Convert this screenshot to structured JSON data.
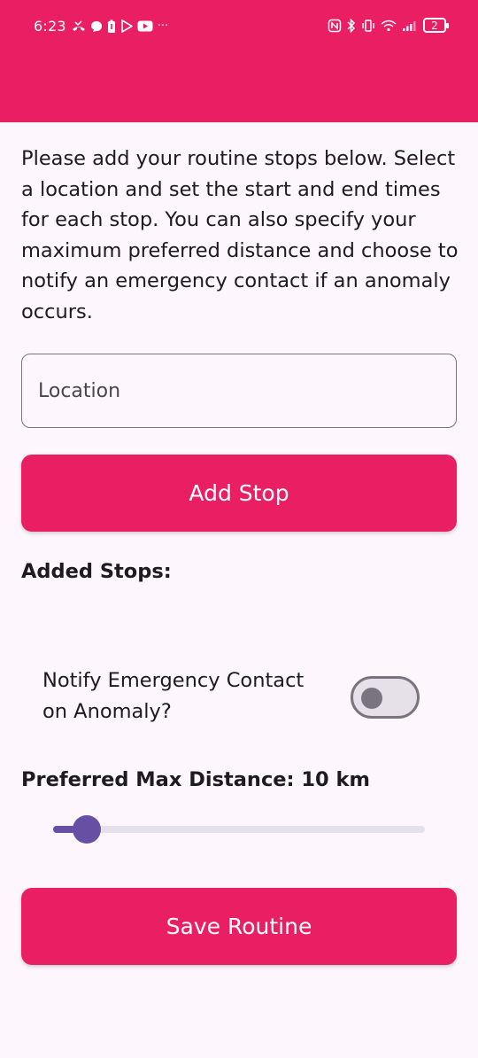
{
  "status_bar": {
    "time": "6:23",
    "left_icons": [
      "missed-call-icon",
      "chat-icon",
      "battery-saver-icon",
      "play-store-icon",
      "youtube-icon",
      "more-dots-icon"
    ],
    "right_icons": [
      "nfc-icon",
      "bluetooth-icon",
      "vibrate-icon",
      "wifi-icon",
      "signal-icon"
    ],
    "battery": "2"
  },
  "colors": {
    "primary": "#e91e63",
    "background": "#fdf6fc",
    "slider_accent": "#6750a4"
  },
  "intro_text": "Please add your routine stops below. Select a location and set the start and end times for each stop. You can also specify your maximum preferred distance and choose to notify an emergency contact if an anomaly occurs.",
  "location_input": {
    "placeholder": "Location",
    "value": ""
  },
  "add_stop_button": "Add Stop",
  "added_stops_label": "Added Stops:",
  "added_stops": [],
  "notify_toggle": {
    "label": "Notify Emergency Contact on Anomaly?",
    "checked": false
  },
  "max_distance": {
    "label": "Preferred Max Distance: 10 km",
    "value": 10,
    "fraction": 0.09
  },
  "save_button": "Save Routine"
}
